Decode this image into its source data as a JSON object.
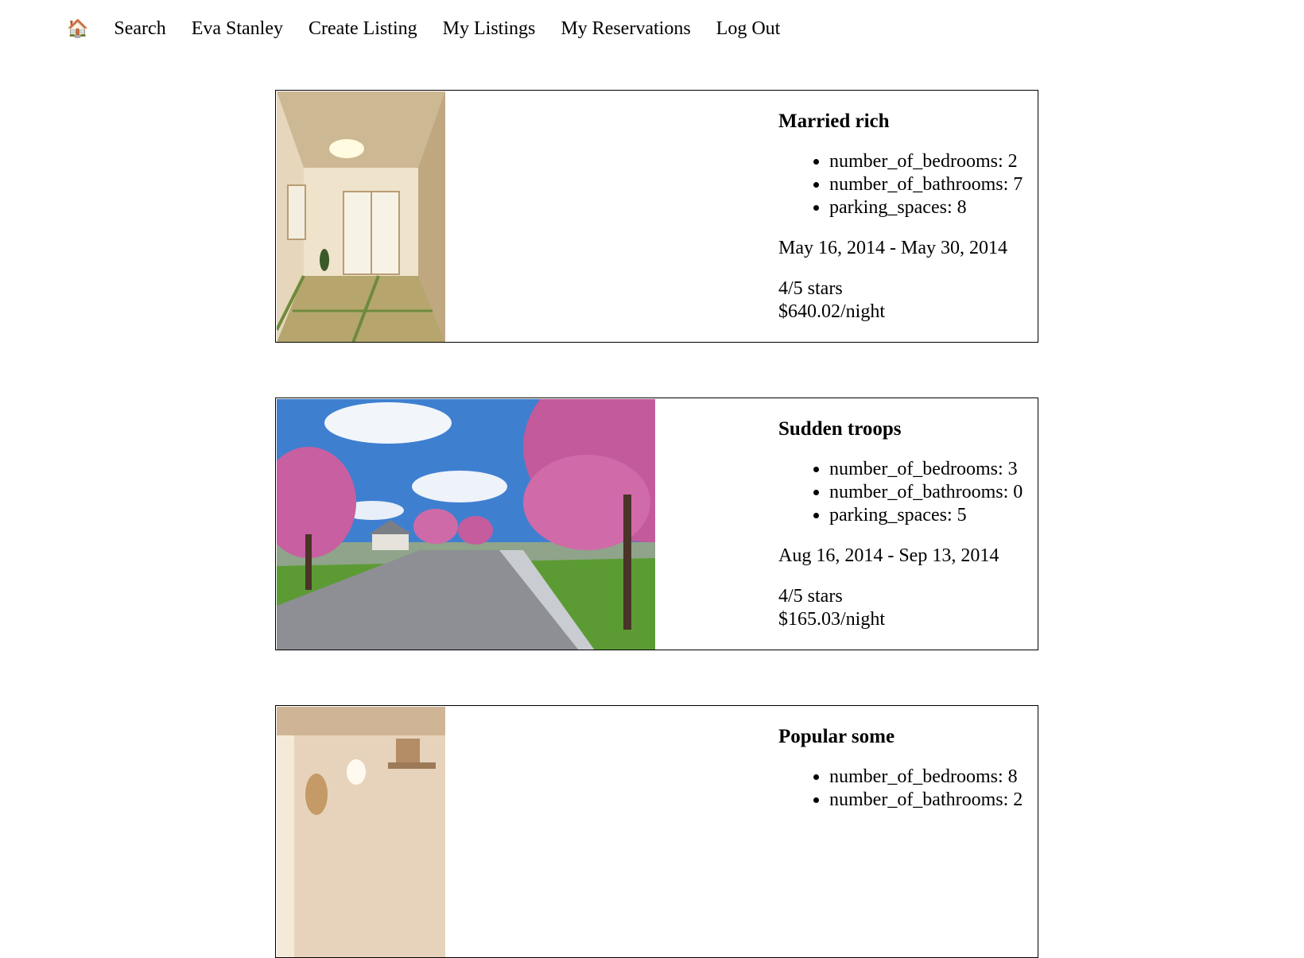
{
  "nav": {
    "home_icon": "🏠",
    "search": "Search",
    "user": "Eva Stanley",
    "create": "Create Listing",
    "my_listings": "My Listings",
    "my_reservations": "My Reservations",
    "logout": "Log Out"
  },
  "listings": [
    {
      "title": "Married rich",
      "bedrooms": "number_of_bedrooms: 2",
      "bathrooms": "number_of_bathrooms: 7",
      "parking": "parking_spaces: 8",
      "dates": "May 16, 2014 - May 30, 2014",
      "rating": "4/5 stars",
      "price": "$640.02/night",
      "photo": "tatami-room-photo"
    },
    {
      "title": "Sudden troops",
      "bedrooms": "number_of_bedrooms: 3",
      "bathrooms": "number_of_bathrooms: 0",
      "parking": "parking_spaces: 5",
      "dates": "Aug 16, 2014 - Sep 13, 2014",
      "rating": "4/5 stars",
      "price": "$165.03/night",
      "photo": "cherry-blossom-street-photo"
    },
    {
      "title": "Popular some",
      "bedrooms": "number_of_bedrooms: 8",
      "bathrooms": "number_of_bathrooms: 2",
      "photo": "rustic-interior-photo"
    }
  ]
}
